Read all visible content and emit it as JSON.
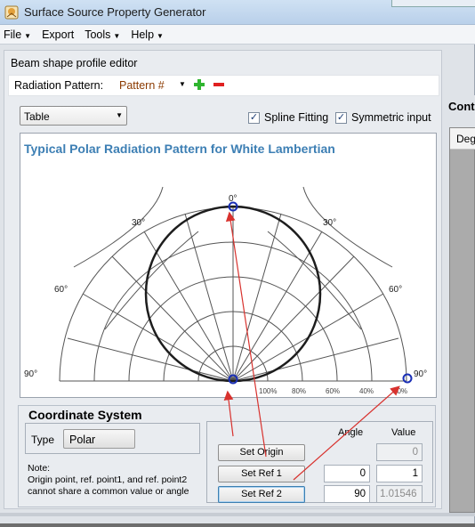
{
  "window": {
    "title": "Surface Source Property Generator"
  },
  "menu": [
    {
      "label": "File",
      "has_arrow": true
    },
    {
      "label": "Export",
      "has_arrow": false
    },
    {
      "label": "Tools",
      "has_arrow": true
    },
    {
      "label": "Help",
      "has_arrow": true
    }
  ],
  "editor": {
    "title": "Beam shape profile editor",
    "radiation_label": "Radiation Pattern:",
    "pattern_value": "Pattern #",
    "add_icon": "plus-icon",
    "remove_icon": "minus-icon"
  },
  "controls": {
    "view_select": "Table",
    "spline_label": "Spline Fitting",
    "spline_checked": true,
    "symmetric_label": "Symmetric input",
    "symmetric_checked": true
  },
  "figure": {
    "title": "Typical Polar Radiation Pattern for White Lambertian",
    "angle_labels": [
      "0°",
      "30°",
      "30°",
      "60°",
      "60°",
      "90°",
      "90°"
    ],
    "bottom_ticks": [
      "100%",
      "80%",
      "60%",
      "40%",
      "20%"
    ]
  },
  "coordinate_system": {
    "title": "Coordinate System",
    "type_label": "Type",
    "type_value": "Polar",
    "note": "Note:\nOrigin point, ref. point1, and ref. point2 cannot share a common value or angle",
    "angle_header": "Angle",
    "value_header": "Value",
    "rows": [
      {
        "button": "Set Origin",
        "angle": "",
        "value": "0",
        "value_disabled": true
      },
      {
        "button": "Set Ref 1",
        "angle": "0",
        "value": "1",
        "value_disabled": false
      },
      {
        "button": "Set Ref 2",
        "angle": "90",
        "value": "1.01546",
        "value_disabled": true
      }
    ]
  },
  "right_panel": {
    "title": "Cont",
    "column_header": "Deg"
  },
  "colors": {
    "marker": "#1a2fb5",
    "arrow": "#d8322e",
    "title_text": "#3d7fb4"
  }
}
